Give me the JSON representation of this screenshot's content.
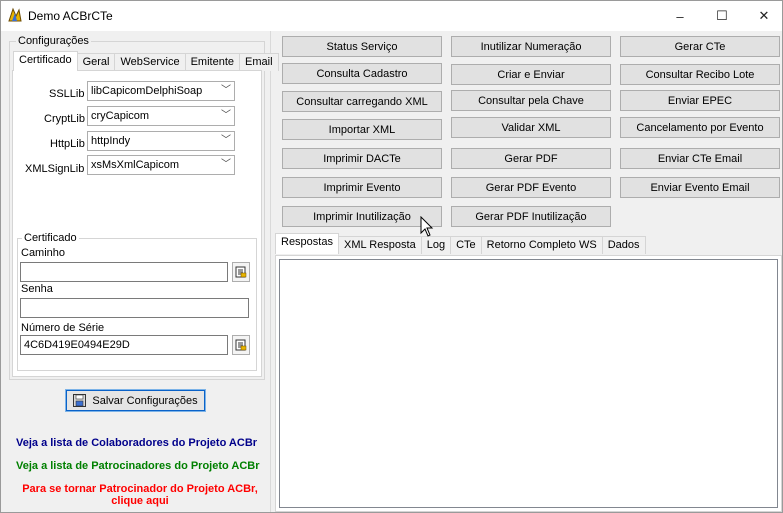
{
  "window": {
    "title": "Demo ACBrCTe",
    "minimize": "–",
    "maximize": "☐",
    "close": "✕"
  },
  "config": {
    "group_title": "Configurações",
    "tabs": [
      "Certificado",
      "Geral",
      "WebService",
      "Emitente",
      "Email"
    ],
    "ssl_label": "SSLLib",
    "ssl_value": "libCapicomDelphiSoap",
    "crypt_label": "CryptLib",
    "crypt_value": "cryCapicom",
    "http_label": "HttpLib",
    "http_value": "httpIndy",
    "xmlsign_label": "XMLSignLib",
    "xmlsign_value": "xsMsXmlCapicom",
    "cert_group_title": "Certificado",
    "path_label": "Caminho",
    "path_value": "",
    "password_label": "Senha",
    "password_value": "",
    "serial_label": "Número de Série",
    "serial_value": "4C6D419E0494E29D"
  },
  "save_button": "Salvar Configurações",
  "links": {
    "collaborators": "Veja a lista de Colaboradores do Projeto ACBr",
    "sponsors": "Veja a lista de Patrocinadores do Projeto ACBr",
    "become_line1": "Para se tornar Patrocinador do Projeto ACBr,",
    "become_line2": "clique aqui"
  },
  "colors": {
    "link_blue": "#00008b",
    "link_green": "#008000",
    "link_red": "#ff0000",
    "focus_border": "#0a62c8"
  },
  "actions": {
    "status_servico": "Status Serviço",
    "inutilizar_numeracao": "Inutilizar Numeração",
    "gerar_cte": "Gerar CTe",
    "consulta_cadastro": "Consulta Cadastro",
    "criar_enviar": "Criar e Enviar",
    "consultar_recibo_lote": "Consultar Recibo Lote",
    "consultar_carregando_xml": "Consultar carregando XML",
    "consultar_chave": "Consultar pela Chave",
    "enviar_epec": "Enviar EPEC",
    "importar_xml": "Importar XML",
    "validar_xml": "Validar XML",
    "cancelamento_evento": "Cancelamento por Evento",
    "imprimir_dacte": "Imprimir DACTe",
    "gerar_pdf": "Gerar PDF",
    "enviar_cte_email": "Enviar CTe Email",
    "imprimir_evento": "Imprimir Evento",
    "gerar_pdf_evento": "Gerar PDF Evento",
    "enviar_evento_email": "Enviar Evento Email",
    "imprimir_inutilizacao": "Imprimir Inutilização",
    "gerar_pdf_inutilizacao": "Gerar PDF Inutilização"
  },
  "output_tabs": [
    "Respostas",
    "XML Resposta",
    "Log",
    "CTe",
    "Retorno Completo WS",
    "Dados"
  ],
  "icons": {
    "app": "app-logo-icon",
    "browse": "folder-browse-icon",
    "save": "save-disk-icon",
    "cursor": "mouse-pointer-icon"
  }
}
